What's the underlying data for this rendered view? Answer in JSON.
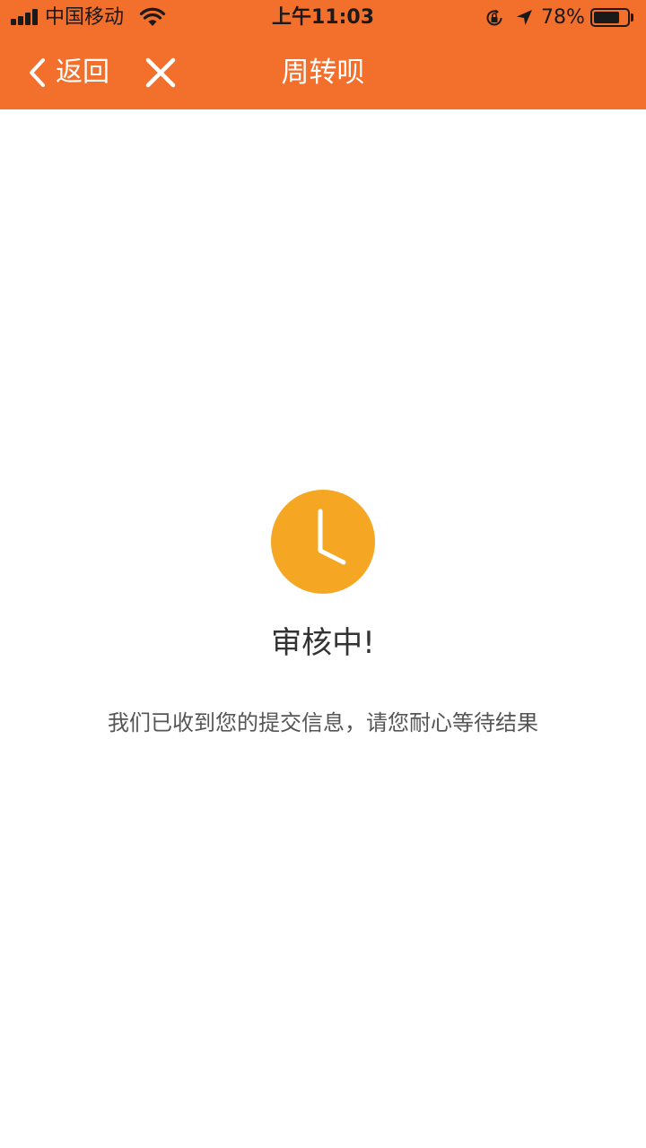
{
  "status_bar": {
    "carrier": "中国移动",
    "time": "上午11:03",
    "battery_percent": "78%",
    "battery_level": 0.78,
    "icons": [
      "signal-icon",
      "wifi-icon",
      "orientation-lock-icon",
      "location-arrow-icon",
      "battery-icon"
    ]
  },
  "nav": {
    "back_label": "返回",
    "title": "周转呗",
    "icons": [
      "chevron-left-icon",
      "close-icon"
    ]
  },
  "main": {
    "icon": "clock-icon",
    "title": "审核中!",
    "message": "我们已收到您的提交信息，请您耐心等待结果"
  },
  "colors": {
    "brand_orange": "#f36f2c",
    "clock_yellow": "#f5a623",
    "title_text": "#333333",
    "message_text": "#555555"
  }
}
